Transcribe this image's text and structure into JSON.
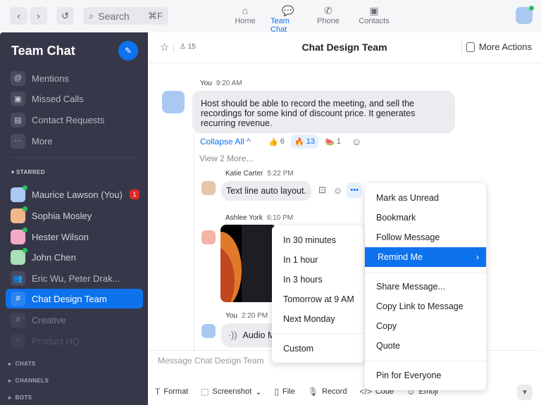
{
  "topbar": {
    "back_icon": "chevron-left-icon",
    "forward_icon": "chevron-right-icon",
    "history_icon": "history-icon",
    "search": {
      "placeholder": "Search",
      "shortcut": "⌘F"
    },
    "tabs": [
      {
        "label": "Home",
        "icon": "home-icon",
        "active": false
      },
      {
        "label": "Team Chat",
        "icon": "chat-icon",
        "active": true
      },
      {
        "label": "Phone",
        "icon": "phone-icon",
        "active": false
      },
      {
        "label": "Contacts",
        "icon": "contacts-icon",
        "active": false
      }
    ]
  },
  "sidebar": {
    "title": "Team Chat",
    "compose_icon": "compose-icon",
    "quick_items": [
      {
        "label": "Mentions",
        "icon": "@"
      },
      {
        "label": "Missed Calls",
        "icon": "▣"
      },
      {
        "label": "Contact Requests",
        "icon": "▤"
      },
      {
        "label": "More",
        "icon": "···"
      }
    ],
    "starred_label": "STARRED",
    "starred": [
      {
        "label": "Maurice Lawson (You)",
        "badge": "1",
        "online": true
      },
      {
        "label": "Sophia Mosley",
        "online": true
      },
      {
        "label": "Hester Wilson",
        "online": true
      },
      {
        "label": "John Chen",
        "online": true
      },
      {
        "label": "Eric Wu, Peter Drak...",
        "icon": "group-icon"
      },
      {
        "label": "Chat Design Team",
        "icon": "#",
        "active": true
      },
      {
        "label": "Creative",
        "icon": "#"
      },
      {
        "label": "Product HQ",
        "icon": "#"
      }
    ],
    "sections": [
      "CHATS",
      "CHANNELS",
      "BOTS"
    ]
  },
  "header": {
    "title": "Chat Design Team",
    "members": "15",
    "more_actions": "More Actions"
  },
  "messages": [
    {
      "sender": "You",
      "time": "9:20 AM",
      "text": "Host should be able to record the meeting, and sell the recordings for some kind of discount price. It generates recurring revenue."
    },
    {
      "sender": "Katie Carter",
      "time": "5:22 PM",
      "text": "Text line auto layout."
    },
    {
      "sender": "Ashlee York",
      "time": "6:10 PM",
      "text": ""
    },
    {
      "sender": "You",
      "time": "2:20 PM",
      "text": "Audio M"
    }
  ],
  "thread": {
    "collapse": "Collapse All ^",
    "reactions": [
      {
        "emoji": "👍",
        "count": "6"
      },
      {
        "emoji": "🔥",
        "count": "13",
        "active": true
      },
      {
        "emoji": "🍉",
        "count": "1"
      }
    ],
    "view_more": "View 2 More..."
  },
  "context_menu": {
    "items": [
      "Mark as Unread",
      "Bookmark",
      "Follow Message",
      "Remind Me",
      "Share Message...",
      "Copy Link to Message",
      "Copy",
      "Quote",
      "Pin for Everyone"
    ],
    "highlighted": "Remind Me"
  },
  "remind_submenu": {
    "items": [
      "In 30 minutes",
      "In 1 hour",
      "In 3 hours",
      "Tomorrow at 9 AM",
      "Next Monday",
      "Custom"
    ]
  },
  "composer": {
    "placeholder": "Message Chat Design Team",
    "tools": [
      "Format",
      "Screenshot",
      "File",
      "Record",
      "Code",
      "Emoji"
    ]
  },
  "colors": {
    "accent": "#0e72ed",
    "sidebar": "#37374a",
    "badge": "#e02828",
    "online": "#22c55e"
  }
}
